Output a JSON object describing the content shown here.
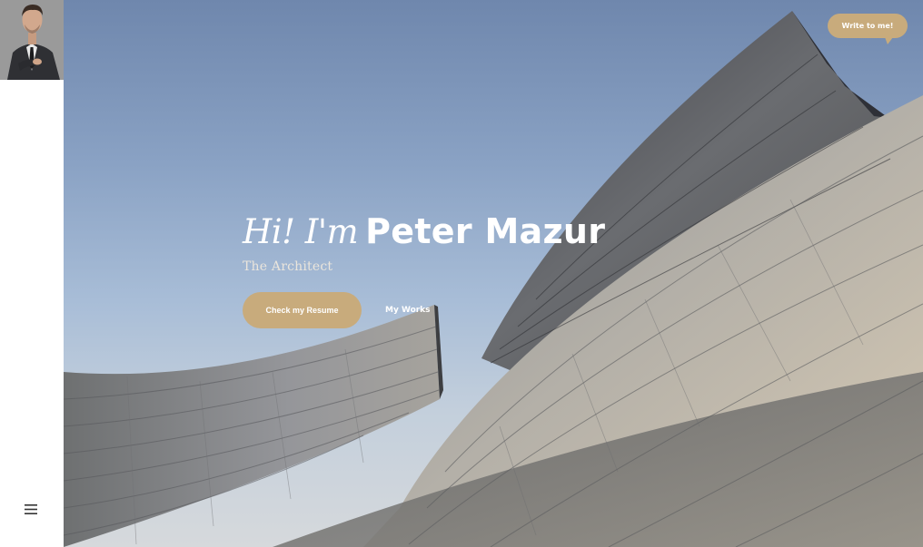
{
  "profile": {
    "avatar_icon": "person-portrait-icon"
  },
  "hero": {
    "greeting": "Hi! I'm",
    "name": "Peter Mazur",
    "subtitle": "The Architect",
    "resume_button": "Check my Resume",
    "works_link": "My Works",
    "contact_button": "Write to me!"
  },
  "sidebar": {
    "menu_icon": "hamburger-menu-icon"
  },
  "colors": {
    "accent": "#c8ab7c",
    "sidebar_bg": "#ffffff",
    "sky_top": "#6f87ad",
    "sky_bottom": "#c3cfdc"
  }
}
